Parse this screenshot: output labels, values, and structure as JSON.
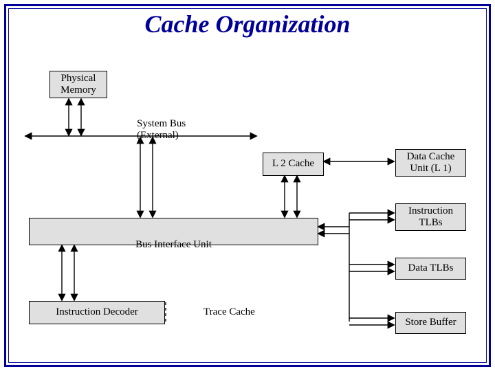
{
  "title": "Cache Organization",
  "boxes": {
    "physical_memory": "Physical\nMemory",
    "system_bus": "System Bus\n(External)",
    "l2_cache": "L 2 Cache",
    "data_cache_l1": "Data Cache\nUnit (L 1)",
    "instruction_tlbs": "Instruction\nTLBs",
    "bus_interface_unit": "Bus Interface Unit",
    "data_tlbs": "Data TLBs",
    "instruction_decoder": "Instruction Decoder",
    "trace_cache": "Trace Cache",
    "store_buffer": "Store Buffer"
  }
}
